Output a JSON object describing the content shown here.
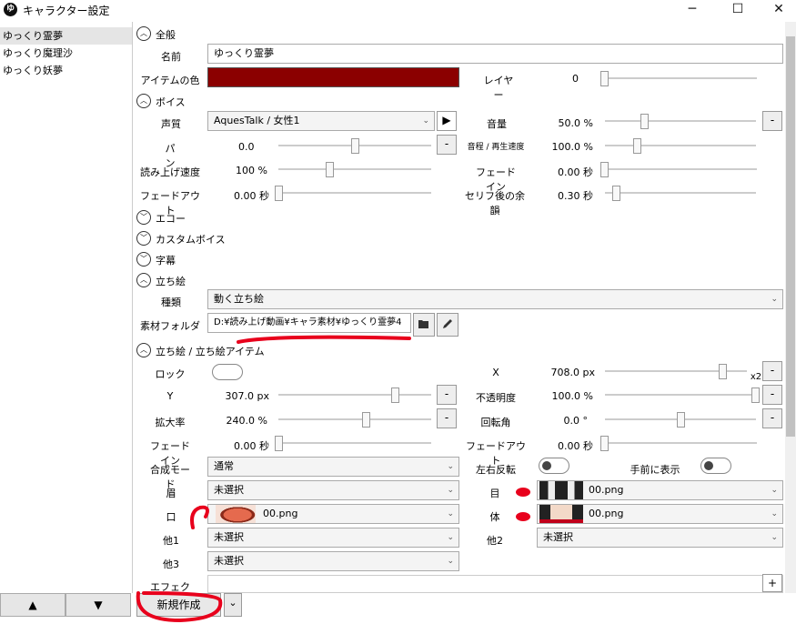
{
  "window": {
    "title": "キャラクター設定",
    "app_icon": "ゆ",
    "min_glyph": "─",
    "max_glyph": "☐",
    "close_glyph": "✕"
  },
  "sidebar": {
    "items": [
      "ゆっくり霊夢",
      "ゆっくり魔理沙",
      "ゆっくり妖夢"
    ],
    "selected": 0,
    "up_label": "▲",
    "down_label": "▼"
  },
  "sections": {
    "general": {
      "title": "全般",
      "expanded": true
    },
    "voice": {
      "title": "ボイス",
      "expanded": true
    },
    "echo": {
      "title": "エコー",
      "expanded": false
    },
    "custom_voice": {
      "title": "カスタムボイス",
      "expanded": false
    },
    "subtitle": {
      "title": "字幕",
      "expanded": false
    },
    "tachie": {
      "title": "立ち絵",
      "expanded": true
    },
    "tachie_item": {
      "title": "立ち絵 / 立ち絵アイテム",
      "expanded": true
    }
  },
  "general": {
    "name_label": "名前",
    "name_value": "ゆっくり霊夢",
    "item_color_label": "アイテムの色",
    "item_color": "#8b0000",
    "layer_label": "レイヤー",
    "layer_value": "0",
    "layer_level": 0.0
  },
  "voice": {
    "quality_label": "声質",
    "quality_value": "AquesTalk / 女性1",
    "play_glyph": "▶",
    "volume_label": "音量",
    "volume_value": "50.0 %",
    "volume_level": 0.25,
    "pan_label": "パン",
    "pan_value": "0.0",
    "pan_level": 0.5,
    "pitch_label": "音程 / 再生速度",
    "pitch_value": "100.0 %",
    "pitch_level": 0.2,
    "read_speed_label": "読み上げ速度",
    "read_speed_value": "100 %",
    "read_speed_level": 0.33,
    "fadein_label": "フェードイン",
    "fadein_value": "0.00 秒",
    "fadein_level": 0.0,
    "fadeout_label": "フェードアウト",
    "fadeout_value": "0.00 秒",
    "fadeout_level": 0.0,
    "margin_label": "セリフ後の余韻",
    "margin_value": "0.30 秒",
    "margin_level": 0.05
  },
  "tachie": {
    "type_label": "種類",
    "type_value": "動く立ち絵",
    "folder_label": "素材フォルダ",
    "folder_value": "D:¥読み上げ動画¥キャラ素材¥ゆっくり霊夢4"
  },
  "tachie_item": {
    "lock_label": "ロック",
    "lock_on": false,
    "x_label": "X",
    "x_value": "708.0 px",
    "x_level": 0.85,
    "x_multiplier": "x2",
    "y_label": "Y",
    "y_value": "307.0 px",
    "y_level": 0.78,
    "opacity_label": "不透明度",
    "opacity_value": "100.0 %",
    "opacity_level": 1.0,
    "zoom_label": "拡大率",
    "zoom_value": "240.0 %",
    "zoom_level": 0.58,
    "rotation_label": "回転角",
    "rotation_value": "0.0 °",
    "rotation_level": 0.5,
    "fadein_label": "フェードイン",
    "fadein_value": "0.00 秒",
    "fadein_level": 0.0,
    "fadeout_label": "フェードアウト",
    "fadeout_value": "0.00 秒",
    "fadeout_level": 0.0,
    "blend_label": "合成モード",
    "blend_value": "通常",
    "flip_label": "左右反転",
    "flip_on": false,
    "front_label": "手前に表示",
    "front_on": false,
    "eyebrow_label": "眉",
    "eyebrow_value": "未選択",
    "eye_label": "目",
    "eye_value": "00.png",
    "mouth_label": "口",
    "mouth_value": "00.png",
    "body_label": "体",
    "body_value": "00.png",
    "other1_label": "他1",
    "other1_value": "未選択",
    "other2_label": "他2",
    "other2_value": "未選択",
    "other3_label": "他3",
    "other3_value": "未選択",
    "effect_label": "エフェクト"
  },
  "footer": {
    "new_button": "新規作成",
    "dropdown_glyph": "⌄",
    "add_glyph": "+"
  },
  "colors": {
    "annotation_red": "#e8001c",
    "item_color": "#8b0000"
  }
}
